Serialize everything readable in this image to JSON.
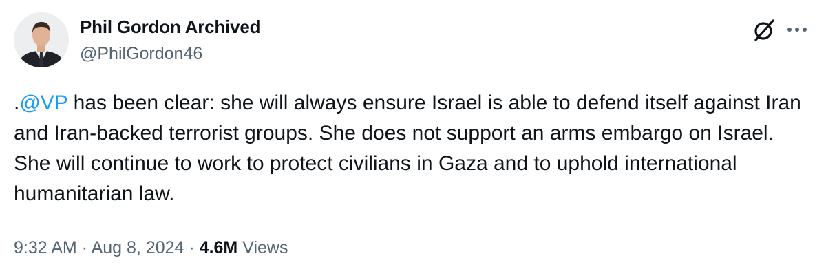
{
  "author": {
    "display_name": "Phil Gordon Archived",
    "handle": "@PhilGordon46"
  },
  "tweet": {
    "prefix": ".",
    "mention": "@VP",
    "text_after_mention": " has been clear: she will always ensure Israel is able to defend itself against Iran and Iran-backed terrorist groups. She does not support an arms embargo on Israel. She will continue to work to protect civilians in Gaza and to uphold international humanitarian law."
  },
  "meta": {
    "time": "9:32 AM",
    "separator": "·",
    "date": "Aug 8, 2024",
    "views_count": "4.6M",
    "views_label": "Views"
  },
  "icons": {
    "grok": "grok-icon",
    "more": "more-icon"
  },
  "colors": {
    "link": "#1d9bf0",
    "secondary_text": "#536471",
    "primary_text": "#0f1419"
  }
}
